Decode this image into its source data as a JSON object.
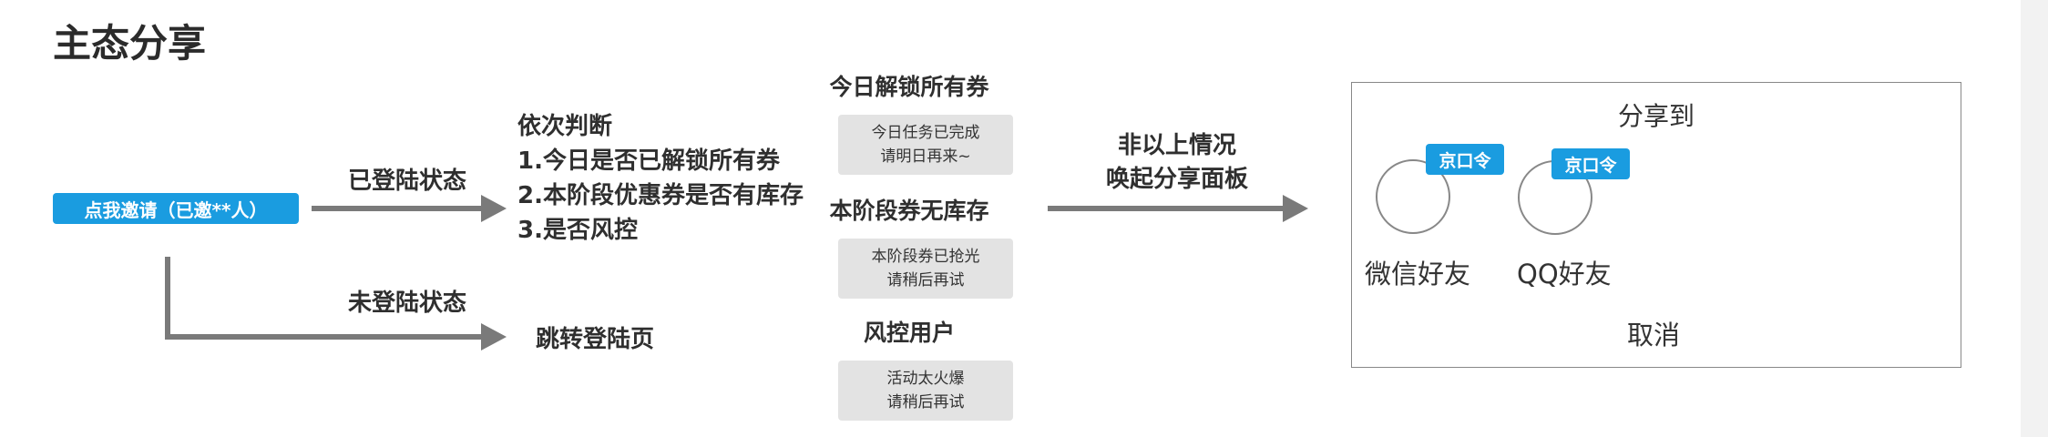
{
  "page_title": "主态分享",
  "start_button": "点我邀请（已邀**人）",
  "edges": {
    "logged_in": "已登陆状态",
    "not_logged_in": "未登陆状态",
    "goto_login": "跳转登陆页"
  },
  "checks": {
    "heading": "依次判断",
    "items": [
      "1.今日是否已解锁所有券",
      "2.本阶段优惠券是否有库存",
      "3.是否风控"
    ]
  },
  "cases": [
    {
      "title": "今日解锁所有券",
      "toast_line1": "今日任务已完成",
      "toast_line2": "请明日再来~"
    },
    {
      "title": "本阶段券无库存",
      "toast_line1": "本阶段券已抢光",
      "toast_line2": "请稍后再试"
    },
    {
      "title": "风控用户",
      "toast_line1": "活动太火爆",
      "toast_line2": "请稍后再试"
    }
  ],
  "otherwise": {
    "line1": "非以上情况",
    "line2": "唤起分享面板"
  },
  "share_panel": {
    "title": "分享到",
    "options": [
      {
        "label": "微信好友",
        "tag": "京口令"
      },
      {
        "label": "QQ好友",
        "tag": "京口令"
      }
    ],
    "cancel": "取消"
  },
  "colors": {
    "accent": "#1a9ce0",
    "arrow": "#7a7a7a",
    "toast_bg": "#e3e3e3"
  }
}
